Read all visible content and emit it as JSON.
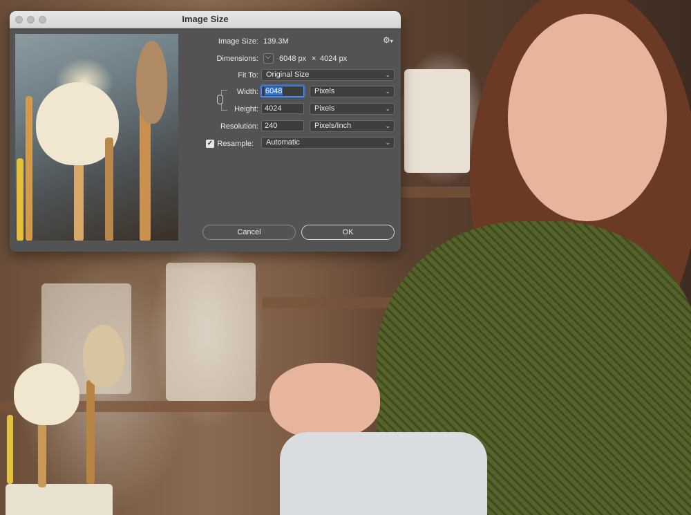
{
  "dialog": {
    "title": "Image Size",
    "image_size": {
      "label": "Image Size:",
      "value": "139.3M"
    },
    "dimensions": {
      "label": "Dimensions:",
      "width_px": "6048 px",
      "times": "×",
      "height_px": "4024 px"
    },
    "fit_to": {
      "label": "Fit To:",
      "selected": "Original Size"
    },
    "width": {
      "label": "Width:",
      "value": "6048",
      "unit": "Pixels"
    },
    "height": {
      "label": "Height:",
      "value": "4024",
      "unit": "Pixels"
    },
    "resolution": {
      "label": "Resolution:",
      "value": "240",
      "unit": "Pixels/Inch"
    },
    "resample": {
      "label": "Resample:",
      "checked": true,
      "selected": "Automatic"
    },
    "buttons": {
      "cancel": "Cancel",
      "ok": "OK"
    },
    "icons": {
      "settings": "gear-icon",
      "dimensions_menu": "chevron-down-icon",
      "constrain": "chain-link-icon"
    }
  },
  "colors": {
    "dialog_bg": "#535353",
    "field_focus": "#3b6fc4",
    "titlebar": "#dcdcdc"
  }
}
